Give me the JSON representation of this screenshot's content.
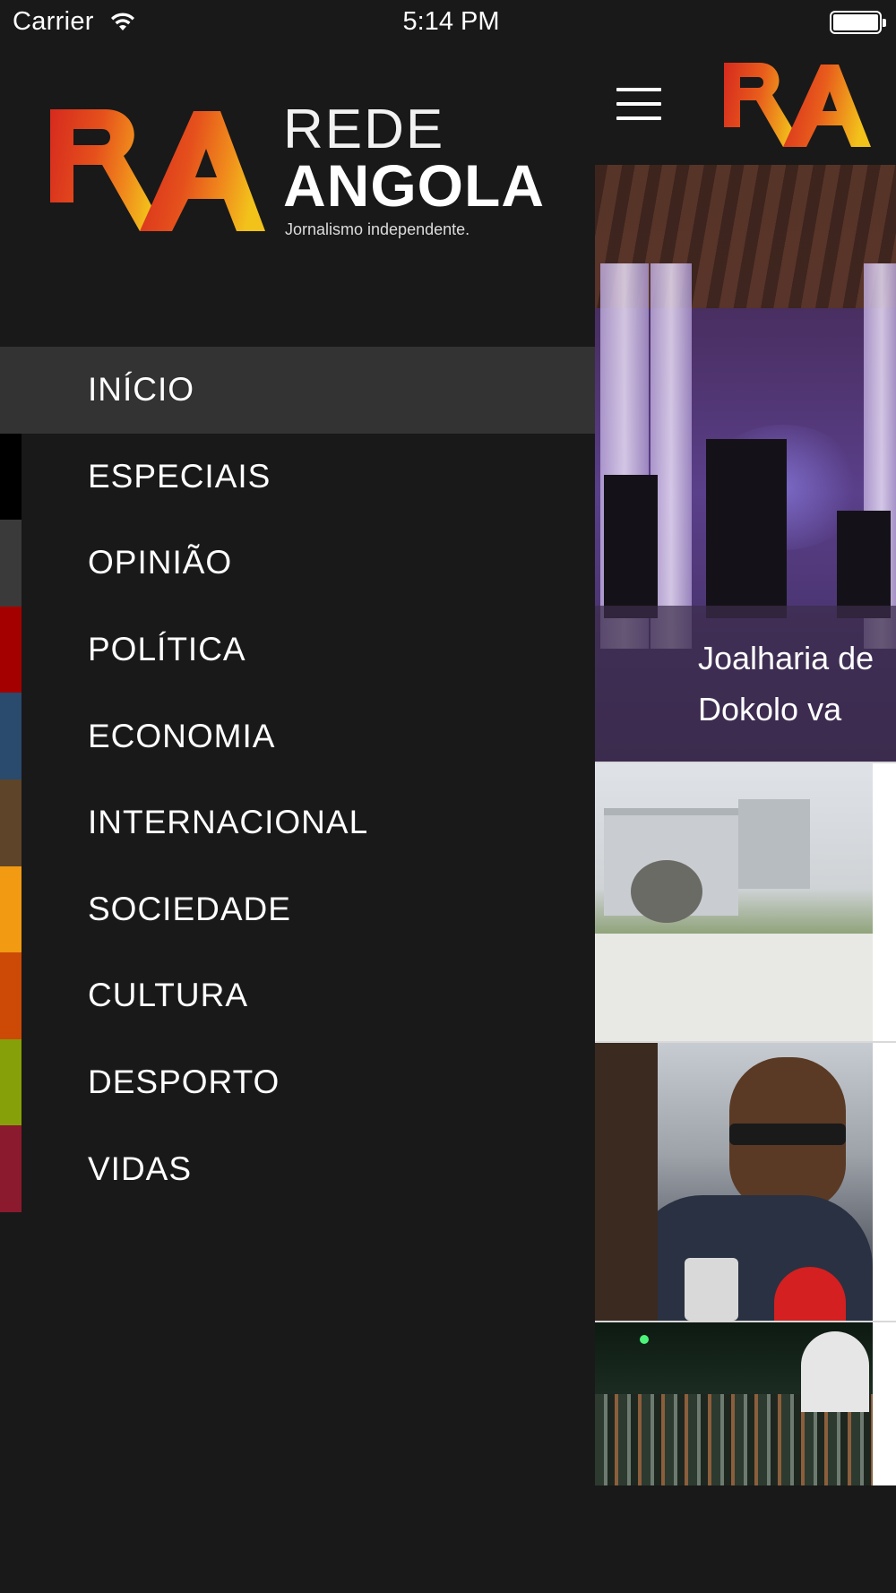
{
  "status_bar": {
    "carrier": "Carrier",
    "time": "5:14 PM",
    "wifi_icon": "wifi-icon",
    "battery_icon": "battery-icon",
    "battery_level": 1.0
  },
  "brand": {
    "line1": "REDE",
    "line2": "ANGOLA",
    "tagline": "Jornalismo independente.",
    "logo_icon": "rede-angola-logo",
    "logo_colors": [
      "#d62a1e",
      "#f08a1c",
      "#f2c21b"
    ]
  },
  "menu": {
    "active_index": 0,
    "items": [
      {
        "label": "INÍCIO",
        "color": "#333333"
      },
      {
        "label": "ESPECIAIS",
        "color": "#000000"
      },
      {
        "label": "OPINIÃO",
        "color": "#3a3a3a"
      },
      {
        "label": "POLÍTICA",
        "color": "#a50000"
      },
      {
        "label": "ECONOMIA",
        "color": "#2a4a6e"
      },
      {
        "label": "INTERNACIONAL",
        "color": "#5e4429"
      },
      {
        "label": "SOCIEDADE",
        "color": "#f29a12"
      },
      {
        "label": "CULTURA",
        "color": "#cc4a06"
      },
      {
        "label": "DESPORTO",
        "color": "#86a009"
      },
      {
        "label": "VIDAS",
        "color": "#8c1a2e"
      }
    ]
  },
  "content": {
    "menu_icon": "hamburger-menu-icon",
    "hero_title": "Joalharia de\nDokolo va"
  }
}
